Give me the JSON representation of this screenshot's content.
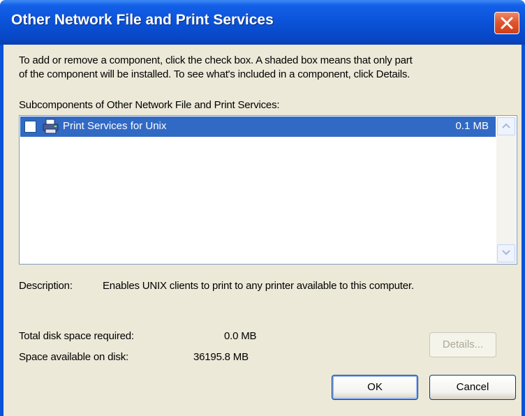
{
  "window": {
    "title": "Other Network File and Print Services"
  },
  "intro": {
    "line1": "To add or remove a component, click the check box. A shaded box means that only part",
    "line2": "of the component will be installed. To see what's included in a component, click Details."
  },
  "subcomponents": {
    "label": "Subcomponents of Other Network File and Print Services:",
    "items": [
      {
        "label": "Print Services for Unix",
        "size": "0.1 MB",
        "checked": false,
        "selected": true,
        "icon": "printer-icon"
      }
    ]
  },
  "description": {
    "label": "Description:",
    "text": "Enables UNIX clients to print to any printer available to this computer."
  },
  "disk": {
    "required_label": "Total disk space required:",
    "required_value": "0.0 MB",
    "available_label": "Space available on disk:",
    "available_value": "36195.8 MB"
  },
  "buttons": {
    "details": "Details...",
    "ok": "OK",
    "cancel": "Cancel"
  },
  "colors": {
    "titlebar": "#0a52d8",
    "selection": "#316ac5",
    "dialog_bg": "#ece9d8",
    "close_button": "#e0562f"
  }
}
